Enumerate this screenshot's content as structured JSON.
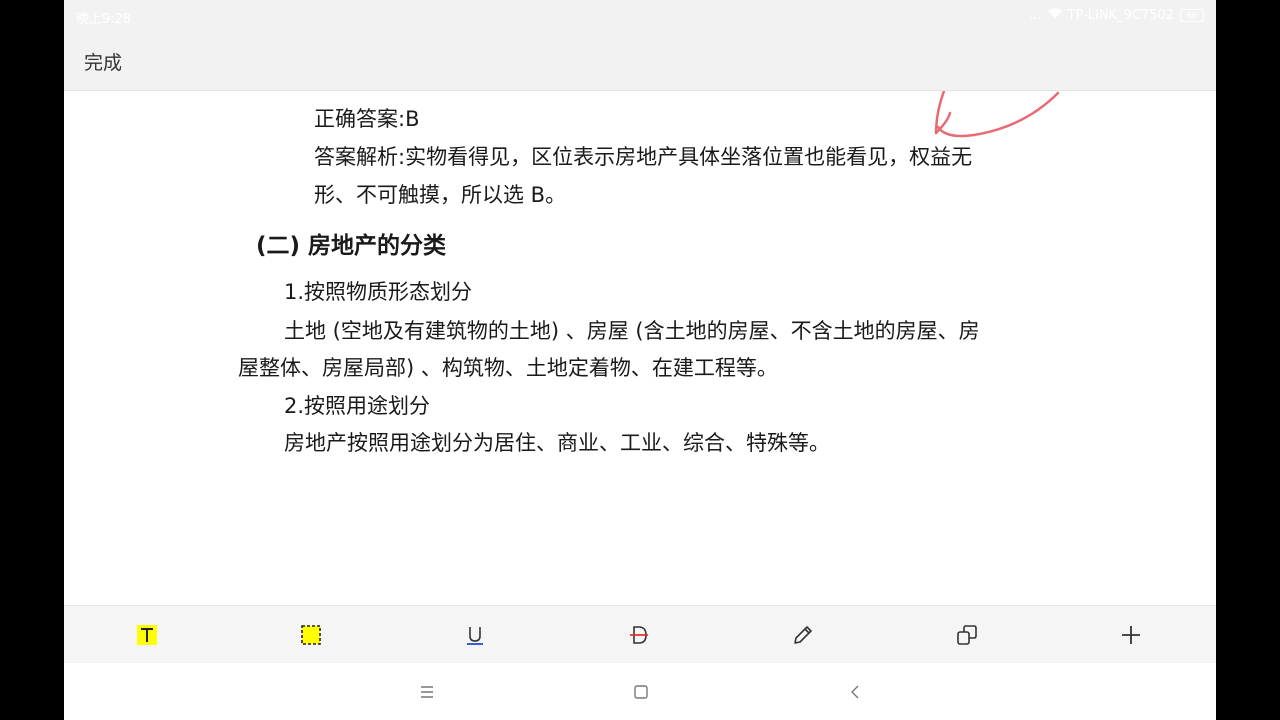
{
  "status_bar": {
    "time": "晚上9:28",
    "dots": "...",
    "wifi_name": "TP-LINK_9C7502",
    "battery": "86"
  },
  "app_bar": {
    "done_label": "完成"
  },
  "document": {
    "answer_line": "正确答案:B",
    "analysis_line1": "答案解析:实物看得见，区位表示房地产具体坐落位置也能看见，权益无",
    "analysis_line2": "形、不可触摸，所以选 B。",
    "section_heading": "(二) 房地产的分类",
    "item1_title": "1.按照物质形态划分",
    "item1_line1": "土地 (空地及有建筑物的土地) 、房屋 (含土地的房屋、不含土地的房屋、房",
    "item1_line2": "屋整体、房屋局部) 、构筑物、土地定着物、在建工程等。",
    "item2_title": "2.按照用途划分",
    "item2_line1": "房地产按照用途划分为居住、商业、工业、综合、特殊等。"
  },
  "toolbar": {
    "tools": [
      "text-highlight-icon",
      "area-select-icon",
      "underline-icon",
      "strikethrough-icon",
      "pencil-icon",
      "copy-icon",
      "add-icon"
    ],
    "highlight_color": "#ffff00",
    "underline_color": "#3b5bdb",
    "strike_color": "#e03131",
    "pen_annotation_color": "#e86a73"
  },
  "navbar": {
    "buttons": [
      "menu-icon",
      "home-icon",
      "back-icon"
    ]
  }
}
